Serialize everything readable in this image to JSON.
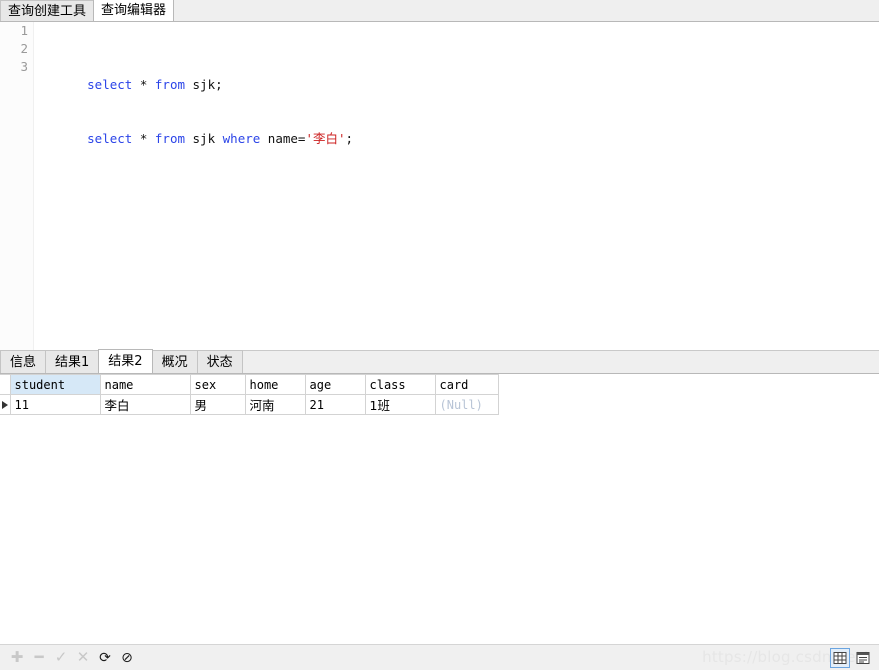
{
  "top_tabs": [
    {
      "label": "查询创建工具",
      "active": false
    },
    {
      "label": "查询编辑器",
      "active": true
    }
  ],
  "editor": {
    "line_numbers": [
      "1",
      "2",
      "3"
    ],
    "lines": [
      {
        "tokens": [
          {
            "t": "select",
            "c": "kw"
          },
          {
            "t": " * ",
            "c": "pl"
          },
          {
            "t": "from",
            "c": "kw"
          },
          {
            "t": " sjk;",
            "c": "pl"
          }
        ]
      },
      {
        "tokens": [
          {
            "t": "select",
            "c": "kw"
          },
          {
            "t": " * ",
            "c": "pl"
          },
          {
            "t": "from",
            "c": "kw"
          },
          {
            "t": " sjk ",
            "c": "pl"
          },
          {
            "t": "where",
            "c": "kw"
          },
          {
            "t": " name=",
            "c": "pl"
          },
          {
            "t": "'李白'",
            "c": "str"
          },
          {
            "t": ";",
            "c": "pl"
          }
        ]
      },
      {
        "tokens": []
      }
    ],
    "full_text": "select * from sjk;\nselect * from sjk where name='李白';\n",
    "keyword_color": "#2b44e8",
    "string_color": "#cc2222",
    "gutter_color": "#9a9a9a"
  },
  "result_tabs": [
    {
      "label": "信息",
      "active": false
    },
    {
      "label": "结果1",
      "active": false
    },
    {
      "label": "结果2",
      "active": true
    },
    {
      "label": "概况",
      "active": false
    },
    {
      "label": "状态",
      "active": false
    }
  ],
  "grid": {
    "columns": [
      {
        "label": "student",
        "width": 90,
        "selected": true,
        "align": "left",
        "cjk": false
      },
      {
        "label": "name",
        "width": 90,
        "selected": false,
        "align": "left",
        "cjk": false
      },
      {
        "label": "sex",
        "width": 55,
        "selected": false,
        "align": "left",
        "cjk": false
      },
      {
        "label": "home",
        "width": 60,
        "selected": false,
        "align": "left",
        "cjk": false
      },
      {
        "label": "age",
        "width": 60,
        "selected": false,
        "align": "left",
        "cjk": false
      },
      {
        "label": "class",
        "width": 70,
        "selected": false,
        "align": "left",
        "cjk": false
      },
      {
        "label": "card",
        "width": 63,
        "selected": false,
        "align": "left",
        "cjk": false
      }
    ],
    "rows": [
      {
        "current": true,
        "cells": [
          {
            "value": "11",
            "align": "left",
            "cjk": false,
            "null": false
          },
          {
            "value": "李白",
            "align": "left",
            "cjk": true,
            "null": false
          },
          {
            "value": "男",
            "align": "left",
            "cjk": true,
            "null": false
          },
          {
            "value": "河南",
            "align": "left",
            "cjk": true,
            "null": false
          },
          {
            "value": "21",
            "align": "right",
            "cjk": false,
            "null": false
          },
          {
            "value": "1班",
            "align": "left",
            "cjk": true,
            "null": false
          },
          {
            "value": "(Null)",
            "align": "left",
            "cjk": false,
            "null": true
          }
        ]
      }
    ],
    "null_color": "#b8c4d6",
    "selected_header_color": "#d6e8f7"
  },
  "bottom_toolbar": {
    "buttons": [
      {
        "name": "add-record-button",
        "glyph": "✚",
        "enabled": false
      },
      {
        "name": "delete-record-button",
        "glyph": "━",
        "enabled": false
      },
      {
        "name": "confirm-edit-button",
        "glyph": "✓",
        "enabled": false
      },
      {
        "name": "cancel-edit-button",
        "glyph": "✕",
        "enabled": false
      },
      {
        "name": "refresh-button",
        "glyph": "⟳",
        "enabled": true
      },
      {
        "name": "stop-button",
        "glyph": "⊘",
        "enabled": true
      }
    ],
    "view_modes": [
      {
        "name": "grid-view-button",
        "icon": "grid-icon",
        "active": true
      },
      {
        "name": "form-view-button",
        "icon": "form-icon",
        "active": false
      }
    ],
    "watermark": "https://blog.csdn.net/"
  }
}
